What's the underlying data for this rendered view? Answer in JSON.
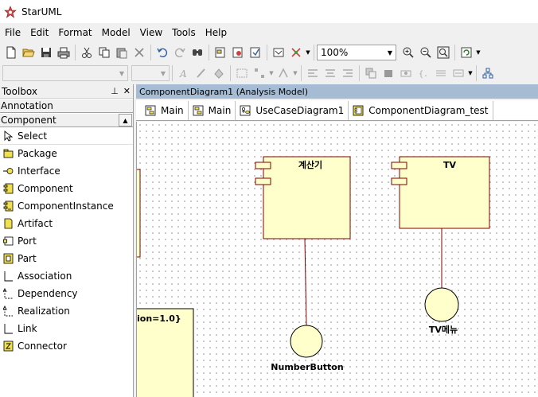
{
  "window": {
    "title": "StarUML"
  },
  "menu": [
    "File",
    "Edit",
    "Format",
    "Model",
    "View",
    "Tools",
    "Help"
  ],
  "toolbar": {
    "zoom": "100%",
    "icons": [
      "new-icon",
      "open-icon",
      "save-icon",
      "print-icon",
      "cut-icon",
      "copy-icon",
      "paste-icon",
      "delete-icon",
      "undo-icon",
      "redo-icon",
      "find-icon",
      "diagram-icon",
      "model-icon",
      "verify-icon",
      "zoom-in-icon",
      "zoom-out-icon",
      "zoom-fit-icon",
      "refresh-icon"
    ]
  },
  "toolbox": {
    "title": "Toolbox",
    "sections": {
      "annotation": "Annotation",
      "component": "Component"
    },
    "items": [
      {
        "label": "Select",
        "icon": "select-arrow-icon"
      },
      {
        "label": "Package",
        "icon": "package-icon"
      },
      {
        "label": "Interface",
        "icon": "interface-icon"
      },
      {
        "label": "Component",
        "icon": "component-icon"
      },
      {
        "label": "ComponentInstance",
        "icon": "component-instance-icon"
      },
      {
        "label": "Artifact",
        "icon": "artifact-icon"
      },
      {
        "label": "Port",
        "icon": "port-icon"
      },
      {
        "label": "Part",
        "icon": "part-icon"
      },
      {
        "label": "Association",
        "icon": "association-icon"
      },
      {
        "label": "Dependency",
        "icon": "dependency-icon"
      },
      {
        "label": "Realization",
        "icon": "realization-icon"
      },
      {
        "label": "Link",
        "icon": "link-icon"
      },
      {
        "label": "Connector",
        "icon": "connector-icon"
      }
    ]
  },
  "diagram": {
    "header": "ComponentDiagram1 (Analysis Model)",
    "tabs": [
      "Main",
      "Main",
      "UseCaseDiagram1",
      "ComponentDiagram_test"
    ],
    "components": [
      "계산기",
      "TV"
    ],
    "interfaces": [
      "NumberButton",
      "TV메뉴"
    ],
    "partial_label": "ion=1.0}"
  },
  "colors": {
    "component_fill": "#ffffcc",
    "component_border": "#7f0000",
    "diagram_header": "#a6bcd4"
  }
}
